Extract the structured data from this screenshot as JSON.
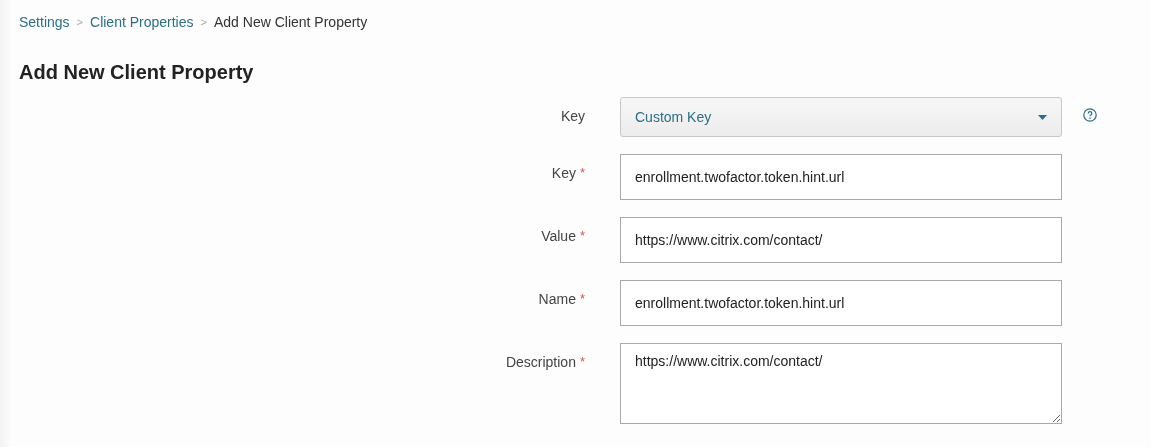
{
  "breadcrumb": {
    "separator": ">",
    "items": [
      {
        "label": "Settings",
        "link": true
      },
      {
        "label": "Client Properties",
        "link": true
      },
      {
        "label": "Add New Client Property",
        "link": false
      }
    ]
  },
  "title": "Add New Client Property",
  "fields": [
    {
      "kind": "select",
      "label": "Key",
      "value": "Custom Key",
      "help": true
    },
    {
      "kind": "text",
      "label": "Key",
      "required_mark": "*",
      "value": "enrollment.twofactor.token.hint.url"
    },
    {
      "kind": "text",
      "label": "Value",
      "required_mark": "*",
      "value": "https://www.citrix.com/contact/"
    },
    {
      "kind": "text",
      "label": "Name",
      "required_mark": "*",
      "value": "enrollment.twofactor.token.hint.url"
    },
    {
      "kind": "textarea",
      "label": "Description",
      "required_mark": "*",
      "value": "https://www.citrix.com/contact/"
    }
  ]
}
